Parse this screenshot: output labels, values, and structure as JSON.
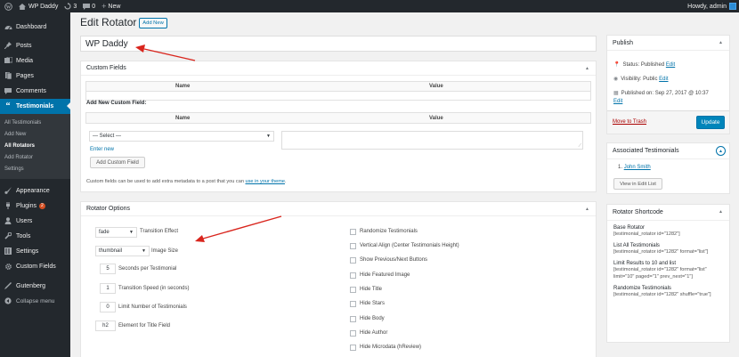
{
  "adminbar": {
    "site_name": "WP Daddy",
    "updates_count": "3",
    "comments_count": "0",
    "new_label": "New",
    "howdy": "Howdy, admin"
  },
  "sidebar": {
    "items": [
      {
        "label": "Dashboard",
        "icon": "dashboard-icon"
      },
      {
        "label": "Posts",
        "icon": "pin-icon"
      },
      {
        "label": "Media",
        "icon": "media-icon"
      },
      {
        "label": "Pages",
        "icon": "pages-icon"
      },
      {
        "label": "Comments",
        "icon": "comment-icon"
      },
      {
        "label": "Testimonials",
        "icon": "quote-icon"
      },
      {
        "label": "Appearance",
        "icon": "brush-icon"
      },
      {
        "label": "Plugins",
        "icon": "plug-icon",
        "badge": "2"
      },
      {
        "label": "Users",
        "icon": "users-icon"
      },
      {
        "label": "Tools",
        "icon": "wrench-icon"
      },
      {
        "label": "Settings",
        "icon": "settings-icon"
      },
      {
        "label": "Custom Fields",
        "icon": "gear-icon"
      },
      {
        "label": "Gutenberg",
        "icon": "pen-icon"
      },
      {
        "label": "Collapse menu",
        "icon": "collapse-icon"
      }
    ],
    "submenu": [
      "All Testimonials",
      "Add New",
      "All Rotators",
      "Add Rotator",
      "Settings"
    ]
  },
  "main": {
    "page_title": "Edit Rotator",
    "add_new_button": "Add New",
    "title_value": "WP Daddy"
  },
  "custom_fields": {
    "title": "Custom Fields",
    "col_name": "Name",
    "col_value": "Value",
    "add_new_label": "Add New Custom Field:",
    "select_value": "— Select —",
    "enter_new": "Enter new",
    "add_button": "Add Custom Field",
    "help_text": "Custom fields can be used to add extra metadata to a post that you can",
    "help_link": "use in your theme",
    "help_end": "."
  },
  "rotator_options": {
    "title": "Rotator Options",
    "transition_value": "fade",
    "transition_label": "Transition Effect",
    "image_size_value": "thumbnail",
    "image_size_label": "Image Size",
    "seconds_value": "5",
    "seconds_label": "Seconds per Testimonial",
    "speed_value": "1",
    "speed_label": "Transition Speed (in seconds)",
    "limit_value": "0",
    "limit_label": "Limit Number of Testimonials",
    "element_value": "h2",
    "element_label": "Element for Title Field",
    "checkboxes": [
      "Randomize Testimonials",
      "Vertical Align (Center Testimonials Height)",
      "Show Previous/Next Buttons",
      "Hide Featured Image",
      "Hide Title",
      "Hide Stars",
      "Hide Body",
      "Hide Author",
      "Hide Microdata (hReview)"
    ]
  },
  "publish": {
    "title": "Publish",
    "status_label": "Status:",
    "status_value": "Published",
    "visibility_label": "Visibility:",
    "visibility_value": "Public",
    "published_on": "Published on: Sep 27, 2017 @ 10:37",
    "edit_label": "Edit",
    "trash_label": "Move to Trash",
    "update_button": "Update"
  },
  "associated": {
    "title": "Associated Testimonials",
    "item_number": "1.",
    "item_link": "John Smith",
    "view_button": "View in Edit List"
  },
  "shortcode": {
    "title": "Rotator Shortcode",
    "blocks": [
      {
        "title": "Base Rotator",
        "code": "[testimonial_rotator id=\"1282\"]"
      },
      {
        "title": "List All Testimonials",
        "code": "[testimonial_rotator id=\"1282\" format=\"list\"]"
      },
      {
        "title": "Limit Results to 10 and list",
        "code": "[testimonial_rotator id=\"1282\" format=\"list\" limit=\"10\" paged=\"1\" prev_next=\"1\"]"
      },
      {
        "title": "Randomize Testimonials",
        "code": "[testimonial_rotator id=\"1282\" shuffle=\"true\"]"
      }
    ]
  },
  "colors": {
    "accent": "#0073aa",
    "sidebar_bg": "#23282d",
    "annotation_arrow": "#d9251d",
    "trash_red": "#a00"
  }
}
